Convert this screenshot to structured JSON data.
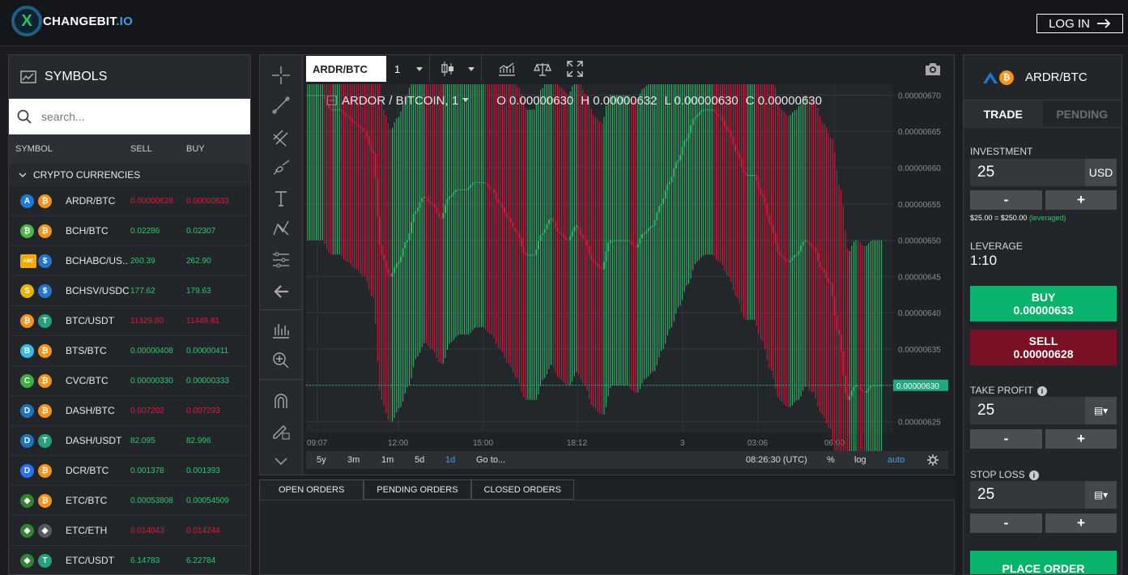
{
  "header": {
    "brand": "CHANGEBIT",
    "brand_suffix": ".IO",
    "logo_letter": "X",
    "login_label": "LOG IN"
  },
  "symbols": {
    "title": "SYMBOLS",
    "search_placeholder": "search...",
    "columns": {
      "symbol": "SYMBOL",
      "sell": "SELL",
      "buy": "BUY"
    },
    "category": "CRYPTO CURRENCIES",
    "rows": [
      {
        "pair": "ARDR/BTC",
        "sell": "0.00000628",
        "buy": "0.00000633",
        "sell_color": "r",
        "buy_color": "r",
        "icons": [
          {
            "t": "A",
            "c": "#1a7ad4"
          },
          {
            "t": "₿",
            "c": "#f7931a"
          }
        ]
      },
      {
        "pair": "BCH/BTC",
        "sell": "0.02286",
        "buy": "0.02307",
        "sell_color": "g",
        "buy_color": "g",
        "icons": [
          {
            "t": "₿",
            "c": "#4cb748"
          },
          {
            "t": "₿",
            "c": "#f7931a"
          }
        ]
      },
      {
        "pair": "BCHABC/US...",
        "sell": "260.39",
        "buy": "262.90",
        "sell_color": "g",
        "buy_color": "g",
        "icons": [
          {
            "t": "ABC",
            "c": "#f2a900"
          },
          {
            "t": "$",
            "c": "#2775ca"
          }
        ]
      },
      {
        "pair": "BCHSV/USDC",
        "sell": "177.62",
        "buy": "179.63",
        "sell_color": "g",
        "buy_color": "g",
        "icons": [
          {
            "t": "S",
            "c": "#eab300"
          },
          {
            "t": "$",
            "c": "#2775ca"
          }
        ]
      },
      {
        "pair": "BTC/USDT",
        "sell": "11329.80",
        "buy": "11449.81",
        "sell_color": "r",
        "buy_color": "r",
        "icons": [
          {
            "t": "₿",
            "c": "#f7931a"
          },
          {
            "t": "T",
            "c": "#26a17b"
          }
        ]
      },
      {
        "pair": "BTS/BTC",
        "sell": "0.00000408",
        "buy": "0.00000411",
        "sell_color": "g",
        "buy_color": "g",
        "icons": [
          {
            "t": "B",
            "c": "#35baeb"
          },
          {
            "t": "₿",
            "c": "#f7931a"
          }
        ]
      },
      {
        "pair": "CVC/BTC",
        "sell": "0.00000330",
        "buy": "0.00000333",
        "sell_color": "g",
        "buy_color": "g",
        "icons": [
          {
            "t": "C",
            "c": "#3ab03e"
          },
          {
            "t": "₿",
            "c": "#f7931a"
          }
        ]
      },
      {
        "pair": "DASH/BTC",
        "sell": "0.007202",
        "buy": "0.007293",
        "sell_color": "r",
        "buy_color": "r",
        "icons": [
          {
            "t": "D",
            "c": "#1c75bc"
          },
          {
            "t": "₿",
            "c": "#f7931a"
          }
        ]
      },
      {
        "pair": "DASH/USDT",
        "sell": "82.095",
        "buy": "82.996",
        "sell_color": "g",
        "buy_color": "g",
        "icons": [
          {
            "t": "D",
            "c": "#1c75bc"
          },
          {
            "t": "T",
            "c": "#26a17b"
          }
        ]
      },
      {
        "pair": "DCR/BTC",
        "sell": "0.001378",
        "buy": "0.001393",
        "sell_color": "g",
        "buy_color": "g",
        "icons": [
          {
            "t": "D",
            "c": "#2970ff"
          },
          {
            "t": "₿",
            "c": "#f7931a"
          }
        ]
      },
      {
        "pair": "ETC/BTC",
        "sell": "0.00053808",
        "buy": "0.00054509",
        "sell_color": "g",
        "buy_color": "g",
        "icons": [
          {
            "t": "◆",
            "c": "#328332"
          },
          {
            "t": "₿",
            "c": "#f7931a"
          }
        ]
      },
      {
        "pair": "ETC/ETH",
        "sell": "0.014043",
        "buy": "0.014244",
        "sell_color": "r",
        "buy_color": "r",
        "icons": [
          {
            "t": "◆",
            "c": "#328332"
          },
          {
            "t": "◆",
            "c": "#555a60"
          }
        ]
      },
      {
        "pair": "ETC/USDT",
        "sell": "6.14783",
        "buy": "6.22784",
        "sell_color": "g",
        "buy_color": "g",
        "icons": [
          {
            "t": "◆",
            "c": "#328332"
          },
          {
            "t": "T",
            "c": "#26a17b"
          }
        ]
      }
    ]
  },
  "chart_toolbar": {
    "symbol": "ARDR/BTC",
    "interval": "1"
  },
  "chart": {
    "legend_title": "ARDOR / BITCOIN, 1",
    "open": "O 0.00000630",
    "high": "H 0.00000632",
    "low": "L 0.00000630",
    "close": "C 0.00000630",
    "last_price_label": "0.00000630"
  },
  "chart_data": {
    "type": "candlestick",
    "x_ticks": [
      "09:07",
      "12:00",
      "15:00",
      "18:12",
      "3",
      "03:06",
      "06:00"
    ],
    "y_ticks": [
      "0.00000670",
      "0.00000665",
      "0.00000660",
      "0.00000655",
      "0.00000650",
      "0.00000645",
      "0.00000640",
      "0.00000635",
      "0.00000630",
      "0.00000625"
    ],
    "ylim": [
      6.235e-06,
      6.715e-06
    ],
    "last_price": 6.3e-06,
    "path": [
      6.7e-06,
      6.7e-06,
      6.68e-06,
      6.68e-06,
      6.67e-06,
      6.66e-06,
      6.65e-06,
      6.62e-06,
      6.48e-06,
      6.45e-06,
      6.47e-06,
      6.5e-06,
      6.54e-06,
      6.56e-06,
      6.55e-06,
      6.53e-06,
      6.56e-06,
      6.57e-06,
      6.57e-06,
      6.58e-06,
      6.58e-06,
      6.57e-06,
      6.55e-06,
      6.53e-06,
      6.51e-06,
      6.48e-06,
      6.48e-06,
      6.51e-06,
      6.53e-06,
      6.51e-06,
      6.5e-06,
      6.52e-06,
      6.5e-06,
      6.47e-06,
      6.46e-06,
      6.5e-06,
      6.5e-06,
      6.5e-06,
      6.49e-06,
      6.51e-06,
      6.52e-06,
      6.55e-06,
      6.58e-06,
      6.61e-06,
      6.64e-06,
      6.67e-06,
      6.68e-06,
      6.68e-06,
      6.67e-06,
      6.65e-06,
      6.62e-06,
      6.59e-06,
      6.59e-06,
      6.56e-06,
      6.52e-06,
      6.48e-06,
      6.47e-06,
      6.48e-06,
      6.5e-06,
      6.49e-06,
      6.46e-06,
      6.44e-06,
      6.37e-06,
      6.28e-06,
      6.3e-06,
      6.29e-06,
      6.3e-06,
      6.3e-06
    ],
    "range": {
      "periods": [
        "5y",
        "3m",
        "1m",
        "5d",
        "1d"
      ],
      "active": "1d",
      "goto": "Go to...",
      "time": "08:26:30 (UTC)",
      "percent": "%",
      "log": "log",
      "auto": "auto"
    }
  },
  "orders": {
    "tabs": [
      "OPEN ORDERS",
      "PENDING ORDERS",
      "CLOSED ORDERS"
    ]
  },
  "trade": {
    "pair": "ARDR/BTC",
    "tabs": {
      "trade": "TRADE",
      "pending": "PENDING"
    },
    "investment_label": "INVESTMENT",
    "investment_value": "25",
    "investment_unit": "USD",
    "minus": "-",
    "plus": "+",
    "leverage_note": "$25.00 = $250.00",
    "leverage_note_suffix": "(leveraged)",
    "leverage_label": "LEVERAGE",
    "leverage_value": "1:10",
    "buy_label": "BUY",
    "buy_price": "0.00000633",
    "sell_label": "SELL",
    "sell_price": "0.00000628",
    "take_profit_label": "TAKE PROFIT",
    "take_profit_value": "25",
    "stop_loss_label": "STOP LOSS",
    "stop_loss_value": "25",
    "place_order": "PLACE ORDER"
  },
  "colors": {
    "green": "#28c76f",
    "red": "#e0173e",
    "buy_bg": "#0ab36b",
    "sell_bg": "#7b1125",
    "accent": "#3c9ee6",
    "price_tag": "#1fa981"
  }
}
